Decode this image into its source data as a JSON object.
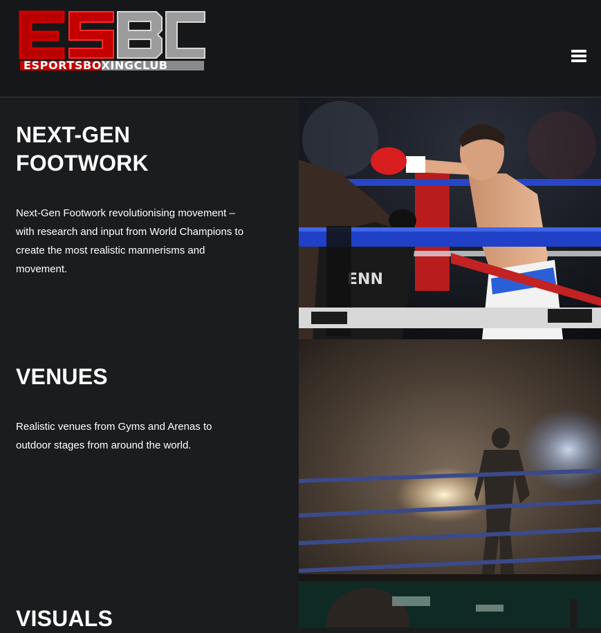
{
  "header": {
    "logo_alt": "ESBC Esports Boxing Club",
    "logo_mark": "ESBC",
    "logo_wordmark": "ESPORTSBOXINGCLUB",
    "menu_icon": "hamburger-menu-icon"
  },
  "features": [
    {
      "title": "NEXT-GEN FOOTWORK",
      "body": "Next-Gen Footwork revolutionising movement – with research and input from World Champions to create the most realistic mannerisms and movement."
    },
    {
      "title": "VENUES",
      "body": "Realistic venues from Gyms and Arenas to outdoor stages from around the world."
    },
    {
      "title": "VISUALS",
      "body": ""
    }
  ],
  "colors": {
    "background": "#1b1c1e",
    "header_background": "#161719",
    "brand_red": "#d40000",
    "text": "#ffffff"
  }
}
